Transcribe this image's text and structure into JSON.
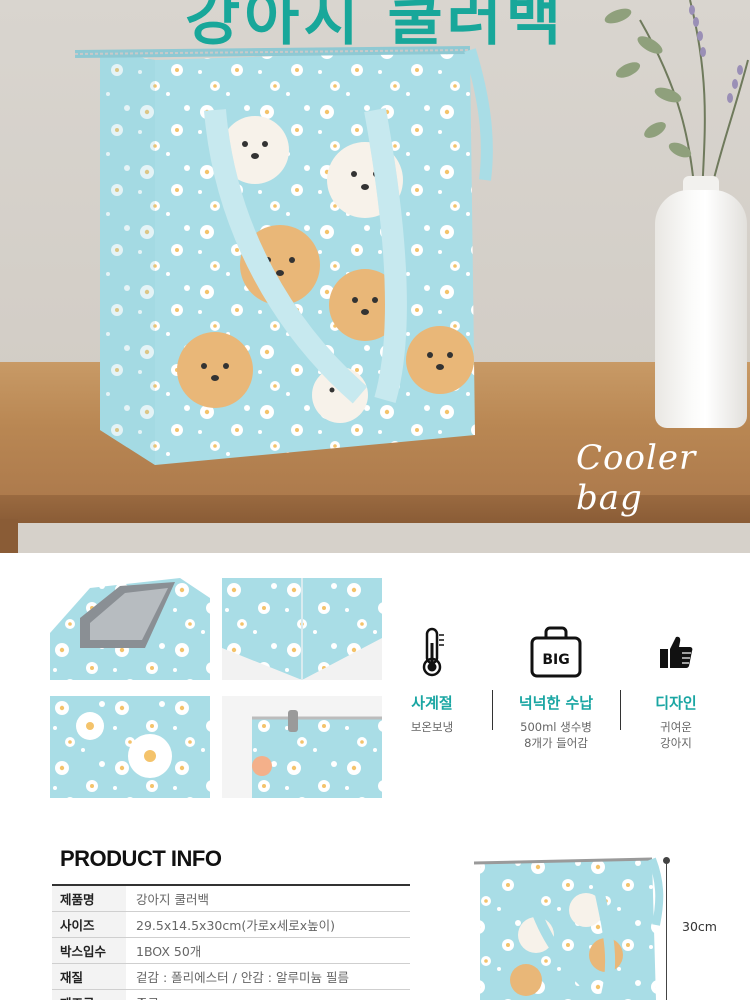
{
  "hero": {
    "title": "강아지 쿨러백",
    "script_text": "Cooler bag"
  },
  "features": [
    {
      "icon": "thermometer-icon",
      "title": "사계절",
      "desc_line1": "보온보냉",
      "desc_line2": ""
    },
    {
      "icon": "big-bag-icon",
      "icon_text": "BIG",
      "title": "넉넉한 수납",
      "desc_line1": "500ml 생수병",
      "desc_line2": "8개가 들어감"
    },
    {
      "icon": "thumbs-up-icon",
      "title": "디자인",
      "desc_line1": "귀여운",
      "desc_line2": "강아지"
    }
  ],
  "product_info": {
    "heading": "PRODUCT INFO",
    "rows": [
      {
        "label": "제품명",
        "value": "강아지 쿨러백"
      },
      {
        "label": "사이즈",
        "value": "29.5x14.5x30cm(가로x세로x높이)"
      },
      {
        "label": "박스입수",
        "value": "1BOX 50개"
      },
      {
        "label": "재질",
        "value": "겉감 : 폴리에스터  / 안감 : 알루미늄 필름"
      },
      {
        "label": "제조국",
        "value": "중국"
      }
    ],
    "height_label": "30cm"
  },
  "colors": {
    "accent": "#1aa6a3",
    "bag_fabric": "#a9dde6",
    "table_wood": "#b98753"
  }
}
